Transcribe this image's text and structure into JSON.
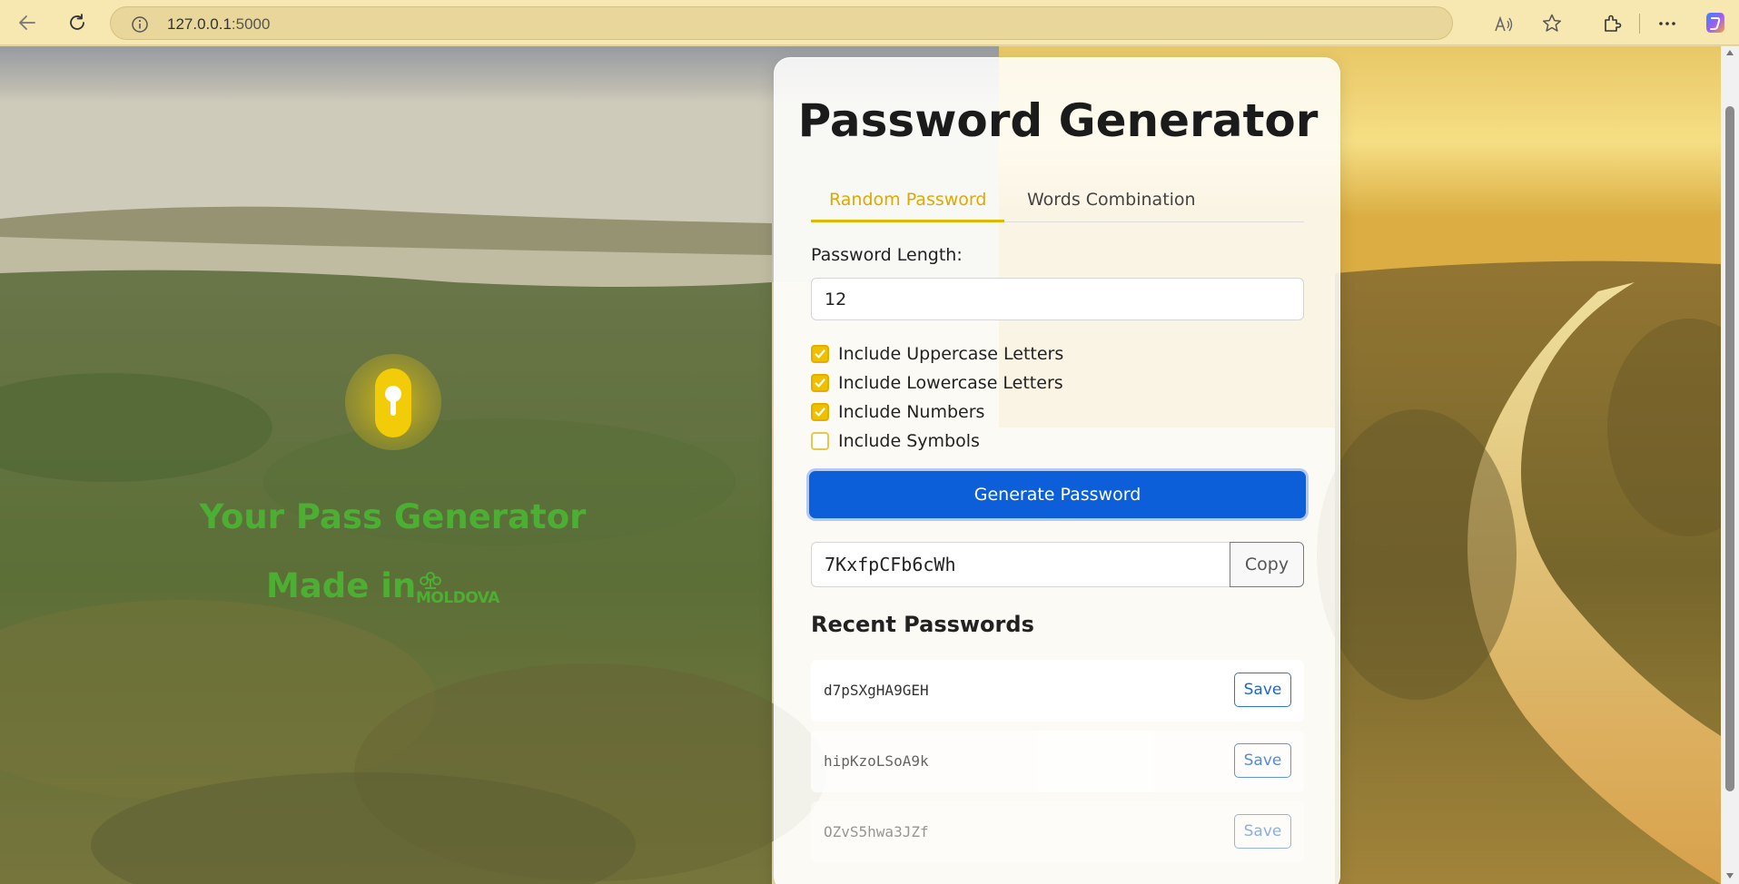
{
  "browser": {
    "url_host": "127.0.0.1",
    "url_port": ":5000"
  },
  "hero": {
    "title": "Your Pass Generator",
    "made_in": "Made in",
    "brand": "MOLDOVA"
  },
  "card": {
    "title": "Password Generator",
    "tabs": [
      {
        "label": "Random Password",
        "active": true
      },
      {
        "label": "Words Combination",
        "active": false
      }
    ],
    "length_label": "Password Length:",
    "length_value": "12",
    "options": [
      {
        "label": "Include Uppercase Letters",
        "checked": true
      },
      {
        "label": "Include Lowercase Letters",
        "checked": true
      },
      {
        "label": "Include Numbers",
        "checked": true
      },
      {
        "label": "Include Symbols",
        "checked": false
      }
    ],
    "generate_label": "Generate Password",
    "generated_password": "7KxfpCFb6cWh",
    "copy_label": "Copy",
    "recent_title": "Recent Passwords",
    "recent": [
      {
        "password": "d7pSXgHA9GEH",
        "save_label": "Save"
      },
      {
        "password": "hipKzoLSoA9k",
        "save_label": "Save"
      },
      {
        "password": "OZvS5hwa3JZf",
        "save_label": "Save"
      }
    ]
  },
  "colors": {
    "accent": "#f0c000",
    "primary_button": "#0d5ed9",
    "hero_text": "#4caf33"
  }
}
